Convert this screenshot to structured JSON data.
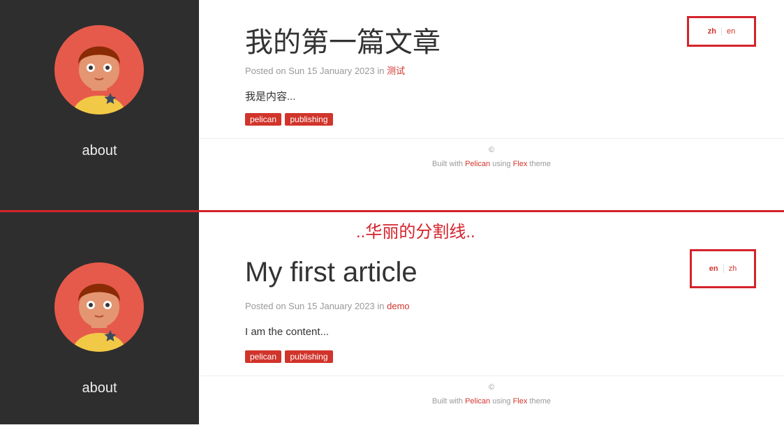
{
  "colors": {
    "accent": "#d1342b",
    "sidebar": "#2e2e2e",
    "annotation": "#d4232b"
  },
  "top": {
    "sidebar_label": "about",
    "title": "我的第一篇文章",
    "meta_prefix": "Posted on Sun 15 January 2023 in",
    "category": "测试",
    "content": "我是内容...",
    "tags": [
      "pelican",
      "publishing"
    ],
    "lang_active": "zh",
    "lang_other": "en"
  },
  "bottom": {
    "sidebar_label": "about",
    "title": "My first article",
    "meta_prefix": "Posted on Sun 15 January 2023 in",
    "category": "demo",
    "content": "I am the content...",
    "tags": [
      "pelican",
      "publishing"
    ],
    "lang_active": "en",
    "lang_other": "zh"
  },
  "footer": {
    "copyright": "©",
    "built_with": "Built with",
    "pelican": "Pelican",
    "using": "using",
    "flex": "Flex",
    "theme": "theme"
  },
  "annotation": "..华丽的分割线.."
}
